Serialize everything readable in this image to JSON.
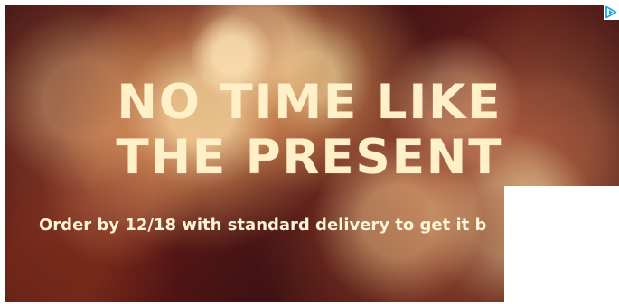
{
  "advertisement": {
    "headline_line_1": "NO TIME LIKE",
    "headline_line_2": "THE PRESENT",
    "subline": "Order by 12/18 with standard delivery to get it b"
  },
  "controls": {
    "adchoices_icon": "play-arrow-icon"
  },
  "colors": {
    "text": "#fff0c8",
    "adchoices": "#1ea5e9"
  }
}
